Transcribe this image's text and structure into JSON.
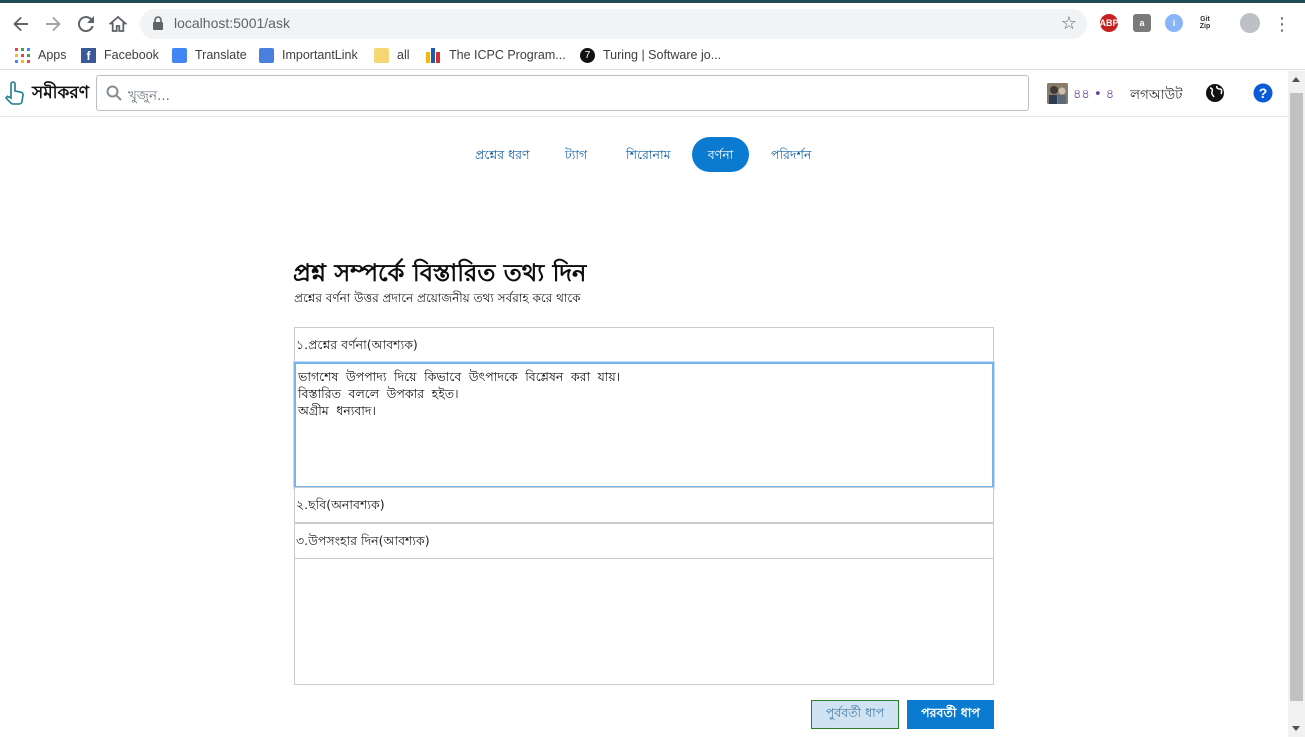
{
  "browser": {
    "url": "localhost:5001/ask",
    "bookmarks": [
      {
        "label": "Apps"
      },
      {
        "label": "Facebook"
      },
      {
        "label": "Translate"
      },
      {
        "label": "ImportantLink"
      },
      {
        "label": "all"
      },
      {
        "label": "The ICPC Program..."
      },
      {
        "label": "Turing | Software jo..."
      }
    ],
    "extensions": {
      "abp": "ABP",
      "a": "a",
      "info": "i",
      "git": "Git Zip"
    }
  },
  "header": {
    "logo_text": "সমীকরণ",
    "search_placeholder": "খুজুন...",
    "reputation": "৪৪ • ৪",
    "logout_label": "লগআউট",
    "globe_icon": "globe-icon",
    "help_icon": "help-icon"
  },
  "steps": [
    {
      "label": "প্রশ্নের ধরণ",
      "active": false
    },
    {
      "label": "ট্যাগ",
      "active": false
    },
    {
      "label": "শিরোনাম",
      "active": false
    },
    {
      "label": "বর্ণনা",
      "active": true
    },
    {
      "label": "পরিদর্শন",
      "active": false
    }
  ],
  "main": {
    "title": "প্রশ্ন সম্পর্কে বিস্তারিত তথ্য দিন",
    "subtitle": "প্রশ্নের বর্ণনা উত্তর প্রদানে প্রয়োজনীয় তথ্য সর্বরাহ করে থাকে",
    "fields": {
      "description_label": "১.প্রশ্নের বর্ণনা(আবশ্যক)",
      "description_value": "ভাগশেষ উপপাদ্য দিয়ে কিভাবে উৎপাদকে বিশ্লেষন করা যায়।\nবিস্তারিত বললে উপকার হইত।\nঅগ্রীম ধন্যবাদ।",
      "image_label": "২.ছবি(অনাবশ্যক)",
      "conclusion_label": "৩.উপসংহার দিন(আবশ্যক)",
      "conclusion_value": ""
    },
    "buttons": {
      "prev": "পুর্ববর্তী ধাপ",
      "next": "পরবর্তী ধাপ"
    }
  },
  "colors": {
    "accent": "#0a7bd0",
    "link": "#0d5fa8"
  }
}
